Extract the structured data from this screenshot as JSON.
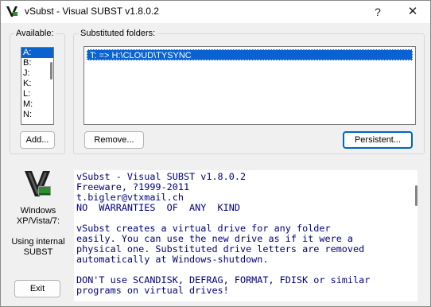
{
  "window": {
    "title": "vSubst - Visual SUBST v1.8.0.2",
    "help_glyph": "?",
    "close_glyph": "✕",
    "icon": "vsubst-app-icon"
  },
  "available": {
    "label": "Available:",
    "drives": [
      "A:",
      "B:",
      "J:",
      "K:",
      "L:",
      "M:",
      "N:"
    ],
    "selected_index": 0,
    "add_button": "Add..."
  },
  "substituted": {
    "label": "Substituted folders:",
    "items": [
      "T: => H:\\CLOUD\\TYSYNC"
    ],
    "remove_button": "Remove...",
    "persistent_button": "Persistent..."
  },
  "info": {
    "logo_icon": "vsubst-logo-icon",
    "os_text": [
      "Windows",
      "XP/Vista/7:"
    ],
    "internal_text": [
      "Using internal",
      "SUBST"
    ],
    "exit_button": "Exit"
  },
  "description": {
    "lines": [
      "vSubst - Visual SUBST v1.8.0.2",
      "Freeware, ?1999-2011",
      "t.bigler@vtxmail.ch",
      "NO  WARRANTIES  OF  ANY  KIND",
      "",
      "vSubst creates a virtual drive for any folder",
      "easily. You can use the new drive as if it were a",
      "physical one. Substituted drive letters are removed",
      "automatically at Windows-shutdown.",
      "",
      "DON'T use SCANDISK, DEFRAG, FORMAT, FDISK or similar",
      "programs on virtual drives!"
    ]
  },
  "colors": {
    "selection": "#0a62d0",
    "desc_text": "#000080",
    "default_button_border": "#0067c0"
  }
}
